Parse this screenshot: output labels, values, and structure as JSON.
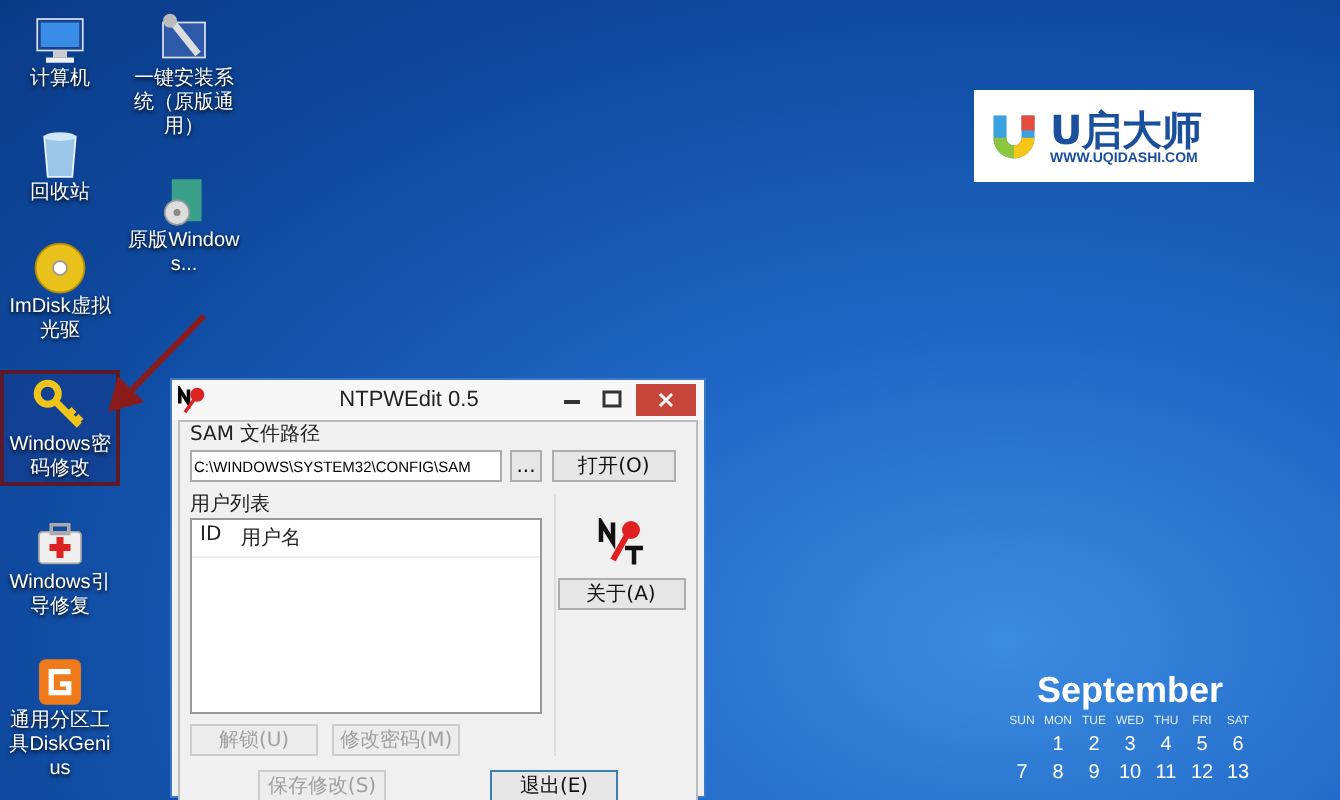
{
  "desktop_columns": [
    [
      {
        "label": "计算机",
        "kind": "computer",
        "selected": false
      },
      {
        "label": "回收站",
        "kind": "recycle-bin",
        "selected": false
      },
      {
        "label": "ImDisk虚拟光驱",
        "kind": "disc",
        "selected": false
      },
      {
        "label": "Windows密码修改",
        "kind": "key",
        "selected": true
      },
      {
        "label": "Windows引导修复",
        "kind": "toolbox",
        "selected": false
      },
      {
        "label": "通用分区工具DiskGenius",
        "kind": "partition",
        "selected": false
      }
    ],
    [
      {
        "label": "一键安装系统（原版通用）",
        "kind": "installer",
        "selected": false
      },
      {
        "label": "原版Windows...",
        "kind": "setup-disc",
        "selected": false
      }
    ]
  ],
  "logo": {
    "name": "U启大师",
    "url": "WWW.UQIDASHI.COM"
  },
  "window": {
    "title": "NTPWEdit 0.5",
    "sam_label": "SAM 文件路径",
    "sam_path": "C:\\WINDOWS\\SYSTEM32\\CONFIG\\SAM",
    "browse_button": "...",
    "open_button": "打开(O)",
    "user_list_label": "用户列表",
    "columns": [
      "ID",
      "用户名"
    ],
    "about_button": "关于(A)",
    "list_buttons": [
      {
        "label": "解锁(U)",
        "disabled": true
      },
      {
        "label": "修改密码(M)",
        "disabled": true
      }
    ],
    "bottom_buttons": [
      {
        "label": "保存修改(S)",
        "disabled": true
      },
      {
        "label": "退出(E)",
        "disabled": false
      }
    ]
  },
  "calendar": {
    "month": "September",
    "weekdays": [
      "SUN",
      "MON",
      "TUE",
      "WED",
      "THU",
      "FRI",
      "SAT"
    ],
    "weeks": [
      [
        "1",
        "2",
        "3",
        "4",
        "5",
        "6"
      ],
      [
        "7",
        "8",
        "9",
        "10",
        "11",
        "12",
        "13"
      ]
    ]
  }
}
